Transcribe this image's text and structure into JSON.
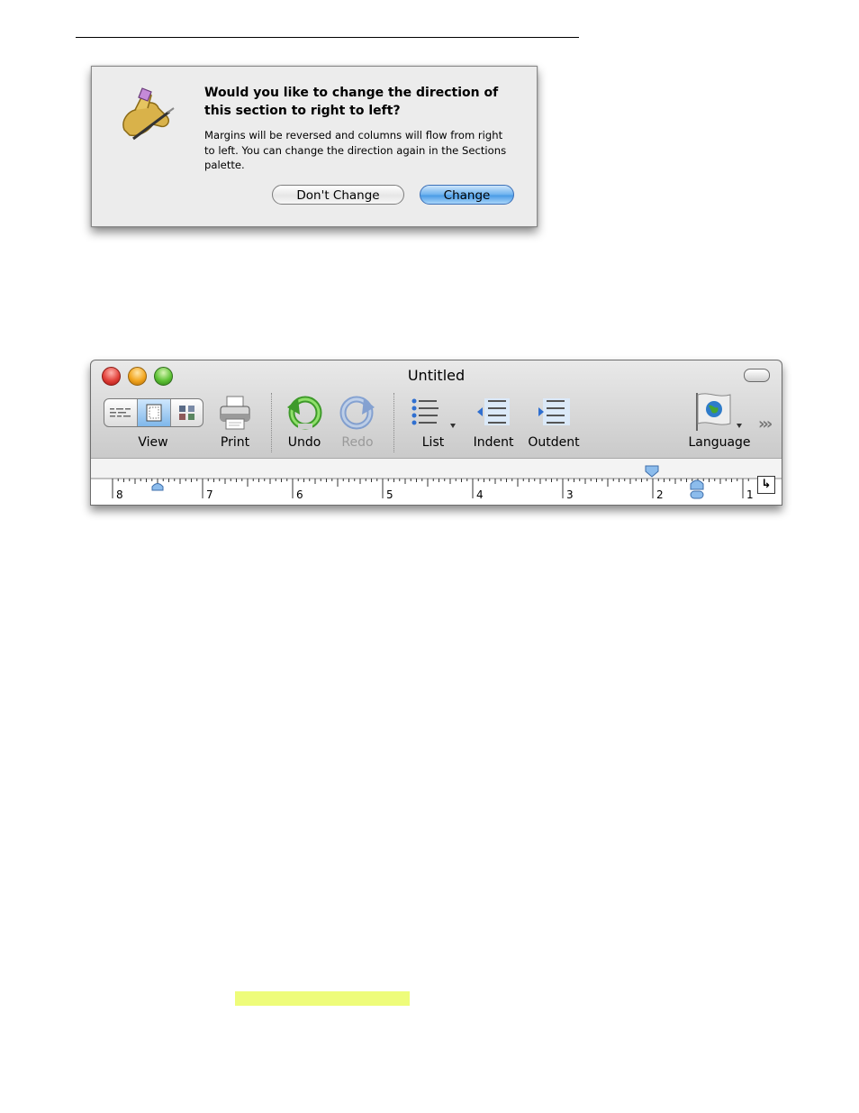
{
  "dialog": {
    "title": "Would you like to change the direction of this section to right to left?",
    "body": "Margins will be reversed and columns will flow from right to left.  You can change the direction again in the Sections palette.",
    "secondary_button": "Don't Change",
    "primary_button": "Change",
    "icon": "writing-hand-pen-icon"
  },
  "window": {
    "title": "Untitled",
    "toolbar": {
      "view": "View",
      "print": "Print",
      "undo": "Undo",
      "redo": "Redo",
      "list": "List",
      "indent": "Indent",
      "outdent": "Outdent",
      "language": "Language"
    },
    "ruler": {
      "labels": [
        "8",
        "7",
        "6",
        "5",
        "4",
        "3",
        "2",
        "1"
      ],
      "tab_button": "↳"
    }
  },
  "colors": {
    "accent_blue": "#6db2ef",
    "highlight": "#eefc7a"
  }
}
